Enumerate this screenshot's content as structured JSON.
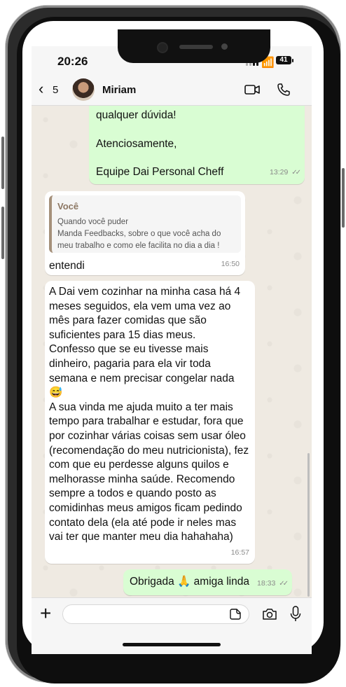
{
  "status": {
    "time": "20:26",
    "battery": "41"
  },
  "header": {
    "back_count": "5",
    "contact_name": "Miriam"
  },
  "messages": [
    {
      "direction": "outgoing",
      "lines": [
        "qualquer dúvida!",
        "",
        "Atenciosamente,",
        "",
        "Equipe Dai Personal Cheff"
      ],
      "text": "qualquer dúvida!\n\nAtenciosamente,\n\nEquipe Dai Personal Cheff",
      "time": "13:29",
      "status": "read"
    },
    {
      "direction": "incoming",
      "quote": {
        "sender": "Você",
        "text": "Quando você puder\nManda Feedbacks, sobre o que você  acha do meu trabalho e como ele  facilita no dia a dia !"
      },
      "text": "entendi",
      "time": "16:50"
    },
    {
      "direction": "incoming",
      "text": "A Dai vem cozinhar na minha casa há 4 meses seguidos, ela vem uma vez ao mês para fazer comidas que são suficientes para 15 dias meus.\nConfesso que se eu tivesse mais dinheiro, pagaria para ela vir toda semana e nem precisar congelar nada 😅\nA sua vinda me ajuda muito a ter mais tempo para trabalhar e estudar, fora que por cozinhar várias coisas sem usar óleo (recomendação do meu nutricionista), fez com que eu perdesse alguns quilos e melhorasse minha saúde. Recomendo sempre a todos e quando posto as comidinhas meus amigos ficam pedindo contato dela (ela até pode ir neles mas vai ter que manter meu dia hahahaha)",
      "time": "16:57"
    },
    {
      "direction": "outgoing",
      "text": "Obrigada 🙏 amiga linda",
      "time": "18:33",
      "status": "read"
    }
  ],
  "composer": {
    "value": "",
    "placeholder": ""
  },
  "icons": [
    "back-chevron-icon",
    "video-call-icon",
    "phone-call-icon",
    "plus-icon",
    "sticker-icon",
    "camera-icon",
    "microphone-icon"
  ],
  "colors": {
    "outgoing_bubble": "#d9fdd3",
    "incoming_bubble": "#ffffff",
    "chat_background": "#efeae2",
    "quote_accent": "#a5907a"
  }
}
